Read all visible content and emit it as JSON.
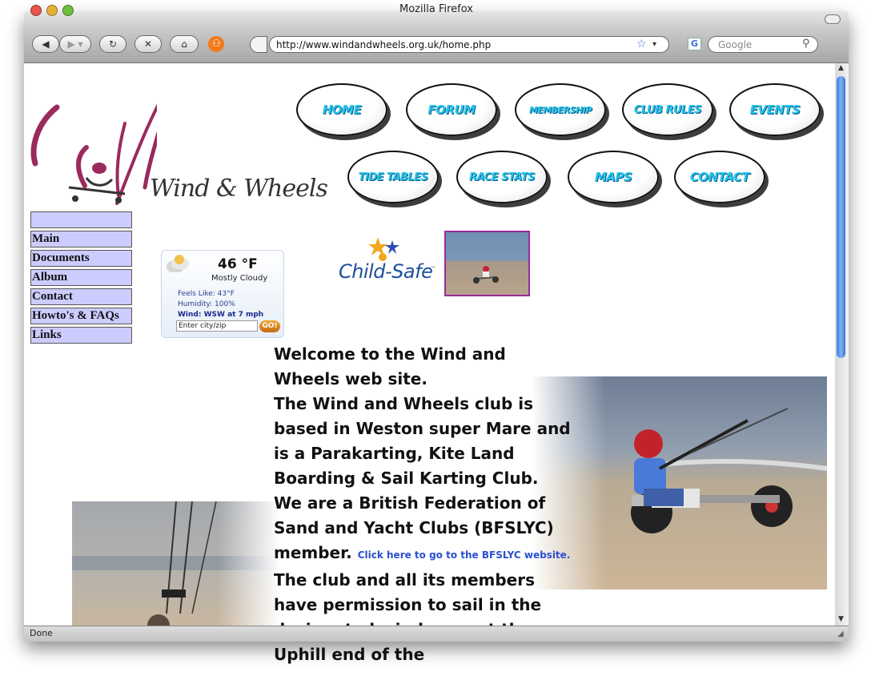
{
  "window": {
    "title": "Mozilla Firefox"
  },
  "toolbar": {
    "url": "http://www.windandwheels.org.uk/home.php",
    "search_placeholder": "Google"
  },
  "status": {
    "text": "Done"
  },
  "logo": {
    "text": "Wind & Wheels"
  },
  "nav": {
    "row1": [
      "HOME",
      "FORUM",
      "MEMBERSHIP",
      "CLUB RULES",
      "EVENTS"
    ],
    "row2": [
      "TIDE TABLES",
      "RACE STATS",
      "MAPS",
      "CONTACT"
    ]
  },
  "menu": {
    "items": [
      "",
      "Main",
      "Documents",
      "Album",
      "Contact",
      "Howto's & FAQs",
      "Links"
    ]
  },
  "weather": {
    "temp": "46 °F",
    "condition": "Mostly Cloudy",
    "feels_like": "Feels Like: 43°F",
    "humidity": "Humidity: 100%",
    "wind": "Wind: WSW at 7 mph",
    "city_value": "Enter city/zip",
    "go_label": "GO!"
  },
  "childsafe": {
    "text": "Child-Safe",
    "tm": "™"
  },
  "main": {
    "p1": "Welcome to the Wind and Wheels web site.",
    "p2": "The Wind and Wheels club is based in Weston super Mare and is a Parakarting, Kite Land Boarding & Sail Karting Club.",
    "p3a": "We are a British Federation of Sand and Yacht Clubs (BFSLYC) member.",
    "p3_link": "Click here to go to the BFSLYC website.",
    "p4": "The club and all its members have permission to sail in the designated wind zone at the Uphill end of the"
  },
  "colors": {
    "nav_text": "#25c4ee",
    "menu_bg": "#ccccff",
    "logo_accent": "#9b2a5c",
    "link": "#2a4fd0"
  }
}
